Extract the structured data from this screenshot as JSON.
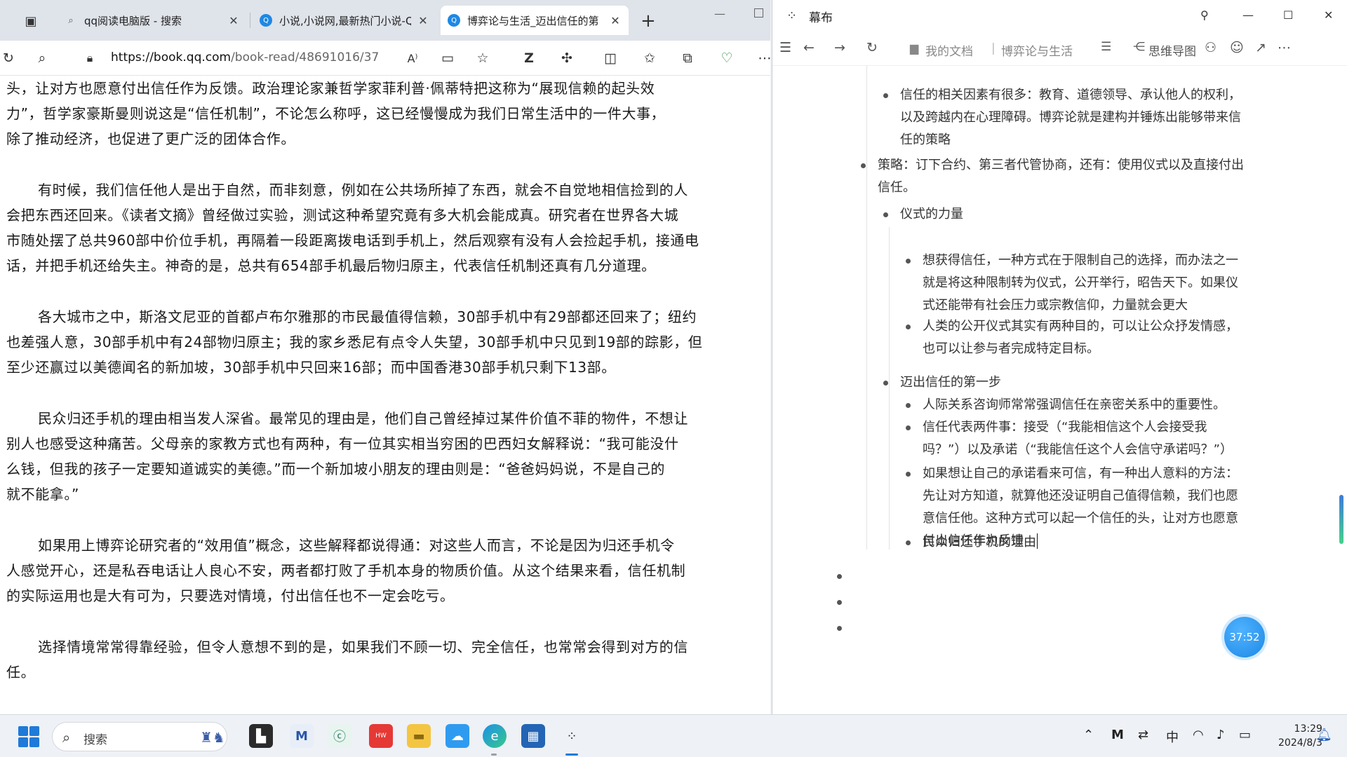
{
  "browser": {
    "tabs": [
      {
        "title": "qq阅读电脑版 - 搜索",
        "icon": "search-icon"
      },
      {
        "title": "小说,小说网,最新热门小说-Q",
        "icon": "qq-icon"
      },
      {
        "title": "博弈论与生活_迈出信任的第",
        "icon": "qq-icon"
      }
    ],
    "url_host": "https://book.qq.com",
    "url_path": "/book-read/48691016/37",
    "reader_lines": [
      {
        "text": "头，让对方也愿意付出信任作为反馈。政治理论家兼哲学家菲利普·佩蒂特把这称为“展现信赖的起头效",
        "indent": false
      },
      {
        "text": "力”，哲学家豪斯曼则说这是“信任机制”，不论怎么称呼，这已经慢慢成为我们日常生活中的一件大事，",
        "indent": false
      },
      {
        "text": "除了推动经济，也促进了更广泛的团体合作。",
        "indent": false
      },
      {
        "text": "有时候，我们信任他人是出于自然，而非刻意，例如在公共场所掉了东西，就会不自觉地相信捡到的人",
        "indent": true
      },
      {
        "text": "会把东西还回来。《读者文摘》曾经做过实验，测试这种希望究竟有多大机会能成真。研究者在世界各大城",
        "indent": false
      },
      {
        "text": "市随处摆了总共960部中价位手机，再隔着一段距离拨电话到手机上，然后观察有没有人会捡起手机，接通电",
        "indent": false
      },
      {
        "text": "话，并把手机还给失主。神奇的是，总共有654部手机最后物归原主，代表信任机制还真有几分道理。",
        "indent": false
      },
      {
        "text": "各大城市之中，斯洛文尼亚的首都卢布尔雅那的市民最值得信赖，30部手机中有29部都还回来了；纽约",
        "indent": true
      },
      {
        "text": "也差强人意，30部手机中有24部物归原主；我的家乡悉尼有点令人失望，30部手机中只见到19部的踪影，但",
        "indent": false
      },
      {
        "text": "至少还赢过以美德闻名的新加坡，30部手机中只回来16部；而中国香港30部手机只剩下13部。",
        "indent": false
      },
      {
        "text": "民众归还手机的理由相当发人深省。最常见的理由是，他们自己曾经掉过某件价值不菲的物件，不想让",
        "indent": true
      },
      {
        "text": "别人也感受这种痛苦。父母亲的家教方式也有两种，有一位其实相当穷困的巴西妇女解释说：“我可能没什",
        "indent": false
      },
      {
        "text": "么钱，但我的孩子一定要知道诚实的美德。”而一个新加坡小朋友的理由则是：“爸爸妈妈说，不是自己的",
        "indent": false
      },
      {
        "text": "就不能拿。”",
        "indent": false
      },
      {
        "text": "如果用上博弈论研究者的“效用值”概念，这些解释都说得通：对这些人而言，不论是因为归还手机令",
        "indent": true
      },
      {
        "text": "人感觉开心，还是私吞电话让人良心不安，两者都打败了手机本身的物质价值。从这个结果来看，信任机制",
        "indent": false
      },
      {
        "text": "的实际运用也是大有可为，只要选对情境，付出信任也不一定会吃亏。",
        "indent": false
      },
      {
        "text": "选择情境常常得靠经验，但令人意想不到的是，如果我们不顾一切、完全信任，也常常会得到对方的信",
        "indent": true
      },
      {
        "text": "任。",
        "indent": false
      }
    ]
  },
  "mubu": {
    "app_name": "幕布",
    "breadcrumb_root": "我的文档",
    "breadcrumb_doc": "博弈论与生活",
    "mindmap_label": "思维导图",
    "outline": [
      {
        "level": 2,
        "lines": [
          "信任的相关因素有很多：教育、道德领导、承认他人的权利，",
          "以及跨越内在心理障碍。博弈论就是建构并锤炼出能够带来信",
          "任的策略"
        ]
      },
      {
        "level": 1,
        "lines": [
          "策略：订下合约、第三者代管协商，还有：使用仪式以及直接付出",
          "信任。"
        ]
      },
      {
        "level": 2,
        "lines": [
          "仪式的力量"
        ]
      },
      {
        "level": 3,
        "lines": [
          "想获得信任，一种方式在于限制自己的选择，而办法之一",
          "就是将这种限制转为仪式，公开举行，昭告天下。如果仪",
          "式还能带有社会压力或宗教信仰，力量就会更大"
        ]
      },
      {
        "level": 3,
        "lines": [
          "人类的公开仪式其实有两种目的，可以让公众抒发情感，",
          "也可以让参与者完成特定目标。"
        ]
      },
      {
        "level": 2,
        "lines": [
          "迈出信任的第一步"
        ]
      },
      {
        "level": 3,
        "lines": [
          "人际关系咨询师常常强调信任在亲密关系中的重要性。"
        ]
      },
      {
        "level": 3,
        "lines": [
          "信任代表两件事：接受（“我能相信这个人会接受我",
          "吗？”）以及承诺（“我能信任这个人会信守承诺吗？”）"
        ]
      },
      {
        "level": 3,
        "lines": [
          "如果想让自己的承诺看来可信，有一种出人意料的方法：",
          "先让对方知道，就算他还没证明自己值得信赖，我们也愿",
          "意信任他。这种方式可以起一个信任的头，让对方也愿意",
          "付出信任作为反馈"
        ]
      },
      {
        "level": 3,
        "lines": [
          "民众归还手机的理由"
        ]
      }
    ],
    "timer": "37:52"
  },
  "taskbar": {
    "search_placeholder": "搜索",
    "ime": "中",
    "time": "13:29",
    "date": "2024/8/3"
  }
}
